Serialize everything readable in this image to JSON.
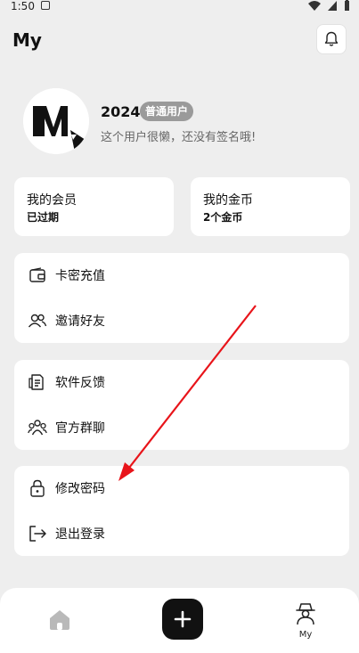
{
  "status": {
    "time": "1:50"
  },
  "header": {
    "title": "My"
  },
  "profile": {
    "username": "2024",
    "badge": "普通用户",
    "signature": "这个用户很懒，还没有签名哦!"
  },
  "membership": {
    "title": "我的会员",
    "value": "已过期"
  },
  "coins": {
    "title": "我的金币",
    "value": "2个金币"
  },
  "menu_group1": [
    {
      "label": "卡密充值",
      "icon": "wallet-icon"
    },
    {
      "label": "邀请好友",
      "icon": "users-icon"
    }
  ],
  "menu_group2": [
    {
      "label": "软件反馈",
      "icon": "feedback-icon"
    },
    {
      "label": "官方群聊",
      "icon": "group-icon"
    }
  ],
  "menu_group3": [
    {
      "label": "修改密码",
      "icon": "lock-icon"
    },
    {
      "label": "退出登录",
      "icon": "logout-icon"
    }
  ],
  "tabbar": {
    "my_label": "My"
  },
  "colors": {
    "background": "#eeeeee",
    "card": "#ffffff",
    "badge": "#9a9a9a",
    "annotation_arrow": "#e8141a"
  }
}
